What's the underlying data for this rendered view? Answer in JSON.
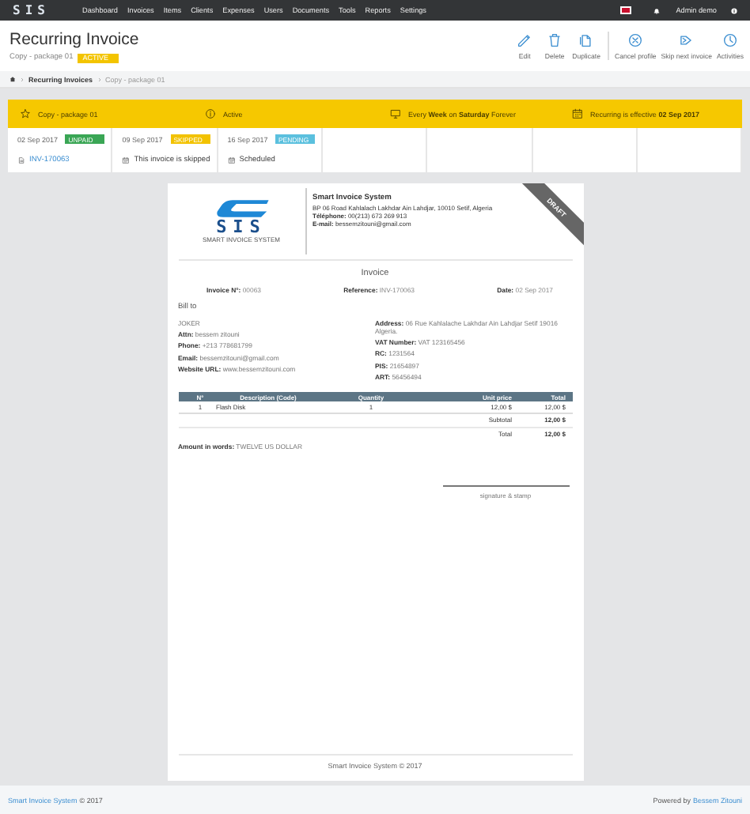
{
  "nav": {
    "logo": "SIS",
    "items": [
      "Dashboard",
      "Invoices",
      "Items",
      "Clients",
      "Expenses",
      "Users",
      "Documents",
      "Tools",
      "Reports",
      "Settings"
    ],
    "user": "Admin demo"
  },
  "header": {
    "title": "Recurring Invoice",
    "subtitle": "Copy - package 01",
    "status": "ACTIVE",
    "actions": [
      "Edit",
      "Delete",
      "Duplicate",
      "Cancel profile",
      "Skip next invoice",
      "Activities"
    ]
  },
  "breadcrumb": [
    "Recurring Invoices",
    "Copy - package 01"
  ],
  "summary": [
    "Copy - package 01",
    "Active",
    "Every **Week** on **Saturday** Forever",
    "Recurring is effective **02 Sep 2017**"
  ],
  "occurrences": [
    {
      "date": "02 Sep 2017",
      "status": "UNPAID",
      "color": "#3aa655",
      "kind": "invoice",
      "text": "INV-170063"
    },
    {
      "date": "09 Sep 2017",
      "status": "SKIPPED",
      "color": "#f2c200",
      "kind": "skipped",
      "text": "This invoice is skipped"
    },
    {
      "date": "16 Sep 2017",
      "status": "PENDING",
      "color": "#5bc0de",
      "kind": "scheduled",
      "text": "Scheduled"
    }
  ],
  "invoice": {
    "ribbon": "DRAFT",
    "logo": "SIS",
    "logo_tagline": "SMART INVOICE SYSTEM",
    "company_name": "Smart Invoice System",
    "company_lines": [
      "BP 06 Road Kahlalach Lakhdar Ain Lahdjar, 10010 Setif, Algeria",
      "**Téléphone:** 00(213) 673 269 913",
      "**E-mail:** bessemzitouni@gmail.com"
    ],
    "title": "Invoice",
    "meta": [
      "**Invoice N°:** 00063",
      "**Reference:** INV-170063",
      "**Date:** 02 Sep 2017"
    ],
    "bill_to": "Bill to",
    "client_left": [
      "JOKER",
      "**Attn:** bessem zitouni",
      "**Phone:** +213 778681799",
      "**Email:** bessemzitouni@gmail.com",
      "**Website URL:** www.bessemzitouni.com"
    ],
    "client_right": [
      "**Address:** 06 Rue Kahlalache Lakhdar Ain Lahdjar Setif 19016 Algeria.",
      "**VAT Number:** VAT 123165456",
      "**RC:** 1231564",
      "**PIS:** 21654897",
      "**ART:** 56456494"
    ],
    "table": {
      "columns": [
        "N°",
        "Description (Code)",
        "Quantity",
        "Unit price",
        "Total"
      ],
      "rows": [
        [
          "1",
          "Flash Disk",
          "1",
          "12,00 $",
          "12,00 $"
        ]
      ],
      "totals": [
        {
          "label": "Subtotal",
          "value": "12,00 $"
        },
        {
          "label": "Total",
          "value": "12,00 $"
        }
      ]
    },
    "amount_in_words": "**Amount in words:** TWELVE US DOLLAR",
    "signature": "signature & stamp",
    "footer": "Smart Invoice System © 2017"
  },
  "footer": {
    "left_link": "Smart Invoice System",
    "left_text": "© 2017",
    "right_text": "Powered by",
    "right_link": "Bessem Zitouni"
  }
}
